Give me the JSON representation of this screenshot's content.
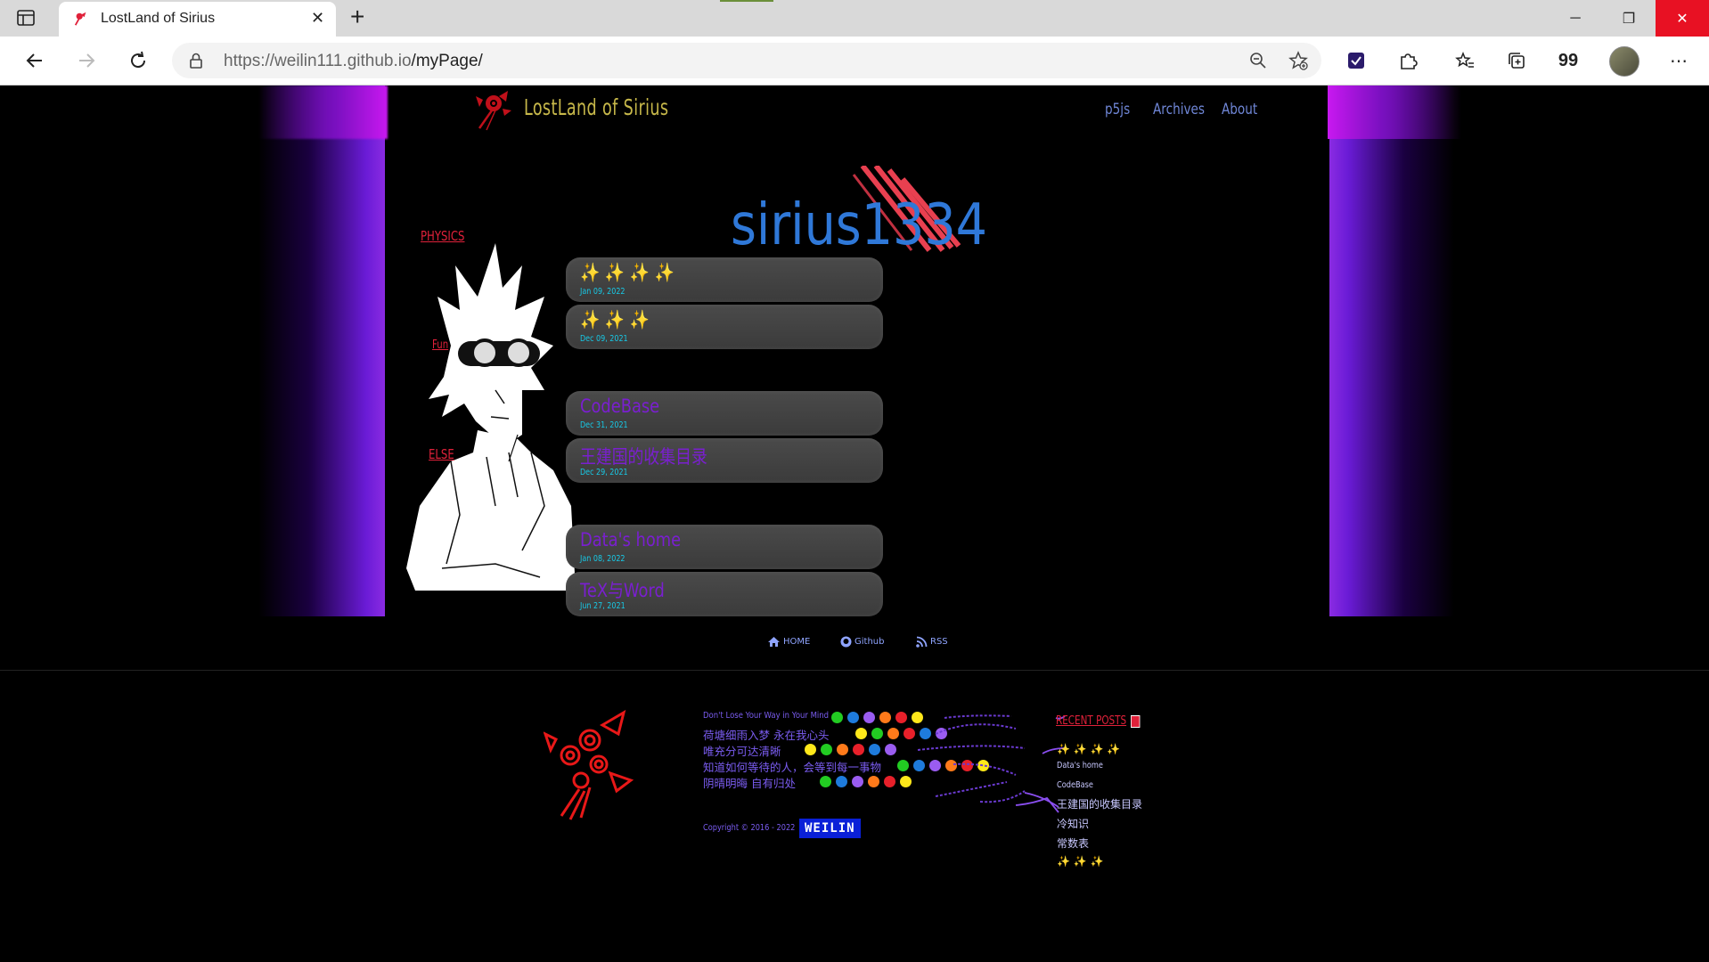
{
  "browser": {
    "tab_title": "LostLand of Sirius",
    "url_host": "https://weilin111.github.io",
    "url_path": "/myPage/"
  },
  "header": {
    "site_title": "LostLand of Sirius",
    "nav": [
      "p5js",
      "Archives",
      "About"
    ]
  },
  "brand": {
    "text": "sirius1334"
  },
  "categories": [
    "PHYSICS",
    "Fun",
    "ELSE"
  ],
  "posts": [
    {
      "title": "✨ ✨ ✨ ✨",
      "date": "Jan 09, 2022"
    },
    {
      "title": "✨ ✨ ✨",
      "date": "Dec 09, 2021"
    },
    {
      "title": "CodeBase",
      "date": "Dec 31, 2021"
    },
    {
      "title": "王建国的收集目录",
      "date": "Dec 29, 2021"
    },
    {
      "title": "Data's home",
      "date": "Jan 08, 2022"
    },
    {
      "title": "TeX与Word",
      "date": "Jun 27, 2021"
    }
  ],
  "footer": {
    "links": [
      "HOME",
      "Github",
      "RSS"
    ],
    "poem": [
      "Don't Lose Your Way in Your Mind",
      "荷塘细雨入梦 永在我心头",
      "唯充分可达清晰",
      "知道如何等待的人，会等到每一事物",
      "阴晴明晦 自有归处"
    ],
    "copyright": "Copyright © 2016 - 2022",
    "badge": "WEILIN",
    "recent_title": "RECENT POSTS",
    "recent_posts": [
      "✨ ✨ ✨ ✨",
      "Data's home",
      "CodeBase",
      "王建国的收集目录",
      "冷知识",
      "常数表",
      "✨ ✨ ✨"
    ]
  },
  "colors": {
    "accent_purple": "#7a1fd0",
    "date_cyan": "#17c9e6",
    "category_red": "#e0213a",
    "title_gold": "#c7b84a",
    "nav_blue": "#6f86d6",
    "dot_palette": [
      "#22cc22",
      "#1e7bdc",
      "#9a5cf0",
      "#ff7a1a",
      "#e8202a",
      "#ffe81a"
    ]
  }
}
